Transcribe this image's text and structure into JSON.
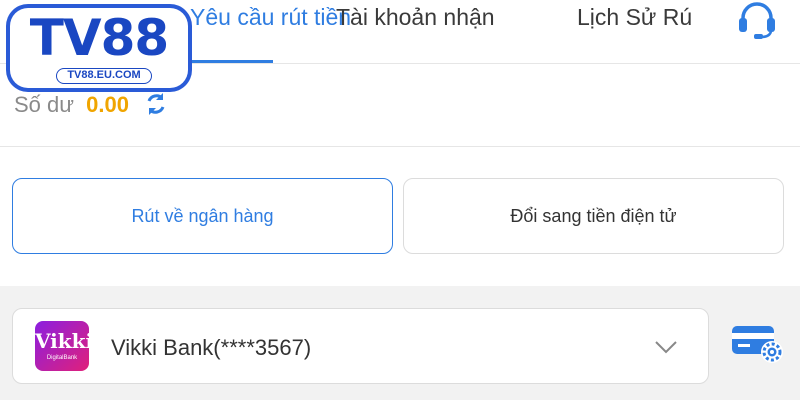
{
  "header": {
    "tabs": [
      {
        "label": "Yêu cầu rút tiền",
        "visible_label": "Yêu cầu rút tiền",
        "active": true
      },
      {
        "label": "Tài khoản nhận",
        "active": false
      },
      {
        "label": "Lịch Sử Rú",
        "active": false
      }
    ],
    "icons": {
      "back": "chevron-left-icon",
      "support": "headset-icon"
    },
    "accent_color": "#2f7de1"
  },
  "logo": {
    "text": "TV88",
    "url": "TV88.EU.COM",
    "color": "#1a47c2"
  },
  "balance": {
    "label": "Số dư",
    "amount": "0.00",
    "amount_color": "#f0a500",
    "icon": "refresh-icon"
  },
  "withdraw_options": [
    {
      "label": "Rút về ngân hàng",
      "selected": true
    },
    {
      "label": "Đổi sang tiền điện tử",
      "selected": false
    }
  ],
  "bank_account": {
    "selected": "Vikki Bank(****3567)",
    "logo_text": "Vikki",
    "logo_subtext": "DigitalBank",
    "dropdown_icon": "chevron-down-icon",
    "settings_icon": "card-settings-icon"
  }
}
